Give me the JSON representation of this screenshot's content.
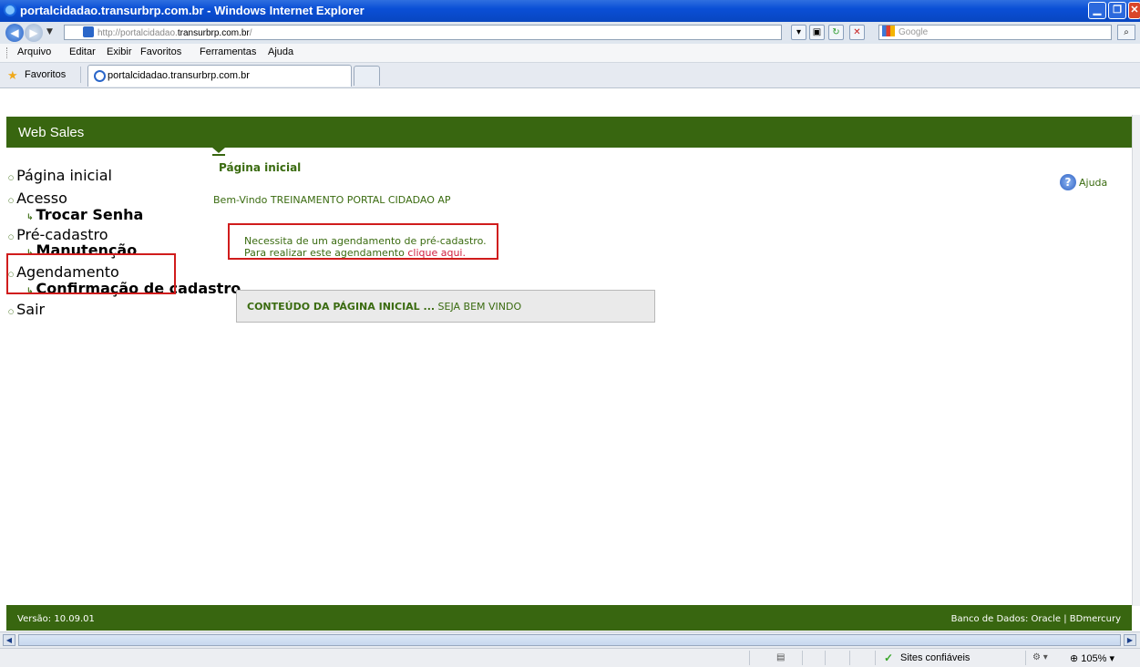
{
  "window": {
    "title": "portalcidadao.transurbrp.com.br - Windows Internet Explorer"
  },
  "address_bar": {
    "url_prefix": "http://portalcidadao.",
    "url_host": "transurbrp.com.br",
    "url_suffix": "/",
    "search_placeholder": "Google"
  },
  "menu": {
    "items": [
      "Arquivo",
      "Editar",
      "Exibir",
      "Favoritos",
      "Ferramentas",
      "Ajuda"
    ]
  },
  "favorites_bar": {
    "label": "Favoritos",
    "tab_label": "portalcidadao.transurbrp.com.br"
  },
  "page": {
    "brand": "Web Sales",
    "sidebar": {
      "items": [
        {
          "label": "Página inicial",
          "level": 0
        },
        {
          "label": "Acesso",
          "level": 0
        },
        {
          "label": "Trocar Senha",
          "level": 1
        },
        {
          "label": "Pré-cadastro",
          "level": 0
        },
        {
          "label": "Manutenção",
          "level": 1
        },
        {
          "label": "Agendamento",
          "level": 0
        },
        {
          "label": "Confirmação de cadastro",
          "level": 1
        },
        {
          "label": "Sair",
          "level": 0
        }
      ]
    },
    "title": "Página inicial",
    "welcome": "Bem-Vindo TREINAMENTO PORTAL CIDADAO AP",
    "notice": {
      "line1": "Necessita de um agendamento de pré-cadastro.",
      "line2_prefix": "Para realizar este agendamento ",
      "link": "clique aqui."
    },
    "help_label": "Ajuda",
    "content_box": {
      "bold": "CONTEÚDO DA PÁGINA INICIAL ...",
      "normal": " SEJA BEM VINDO"
    },
    "footer": {
      "version": "Versão: 10.09.01",
      "database": "Banco de Dados: Oracle | BDmercury"
    }
  },
  "status_bar": {
    "zone": "Sites confiáveis",
    "zoom": "105%"
  },
  "colors": {
    "brand_green": "#386610",
    "text_green": "#3a6b10",
    "highlight_red": "#d01c1c",
    "link_red": "#d01c3c"
  }
}
